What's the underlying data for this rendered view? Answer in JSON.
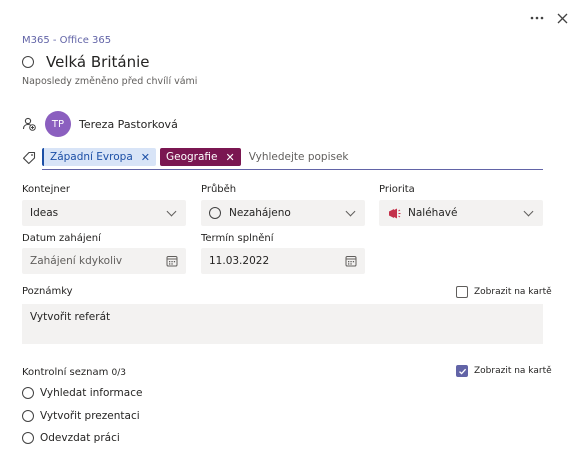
{
  "header": {
    "more_icon": "ellipsis-icon",
    "close_icon": "close-icon"
  },
  "task": {
    "breadcrumb": "M365 - Office 365",
    "title": "Velká Británie",
    "subtitle": "Naposledy změněno před chvílí vámi"
  },
  "assignee": {
    "initials": "TP",
    "name": "Tereza Pastorková",
    "avatar_color": "#8b5fbf"
  },
  "labels": {
    "tags": [
      {
        "text": "Západní Evropa",
        "color": "#1c4fa6"
      },
      {
        "text": "Geografie",
        "color": "#7a1651"
      }
    ],
    "placeholder": "Vyhledejte popisek"
  },
  "fields": {
    "container": {
      "label": "Kontejner",
      "value": "Ideas"
    },
    "progress": {
      "label": "Průběh",
      "value": "Nezahájeno"
    },
    "priority": {
      "label": "Priorita",
      "value": "Naléhavé"
    },
    "start_date": {
      "label": "Datum zahájení",
      "value": "Zahájení kdykoliv"
    },
    "due_date": {
      "label": "Termín splnění",
      "value": "11.03.2022"
    }
  },
  "notes": {
    "label": "Poznámky",
    "value": "Vytvořit referát",
    "show_on_card": "Zobrazit na kartě",
    "show_on_card_checked": false
  },
  "checklist": {
    "label": "Kontrolní seznam",
    "count": "0/3",
    "show_on_card": "Zobrazit na kartě",
    "show_on_card_checked": true,
    "items": [
      "Vyhledat informace",
      "Vytvořit prezentaci",
      "Odevzdat práci"
    ]
  },
  "colors": {
    "accent": "#6264a7",
    "priority_urgent": "#c4314b"
  }
}
